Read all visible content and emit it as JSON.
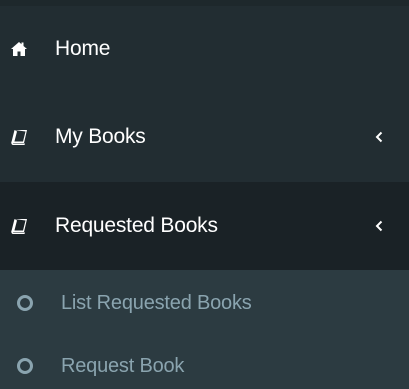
{
  "sidebar": {
    "items": [
      {
        "label": "Home",
        "icon": "home-icon"
      },
      {
        "label": "My Books",
        "icon": "book-icon",
        "chevron": "chevron-left-icon"
      },
      {
        "label": "Requested Books",
        "icon": "book-icon",
        "chevron": "chevron-left-icon",
        "active": true,
        "submenu": [
          {
            "label": "List Requested Books",
            "icon": "circle-outline-icon"
          },
          {
            "label": "Request Book",
            "icon": "circle-outline-icon"
          }
        ]
      }
    ]
  },
  "colors": {
    "background": "#222d32",
    "active_background": "#1a2226",
    "submenu_background": "#2c3b41",
    "submenu_text": "#8aa4af",
    "text": "#ffffff"
  }
}
